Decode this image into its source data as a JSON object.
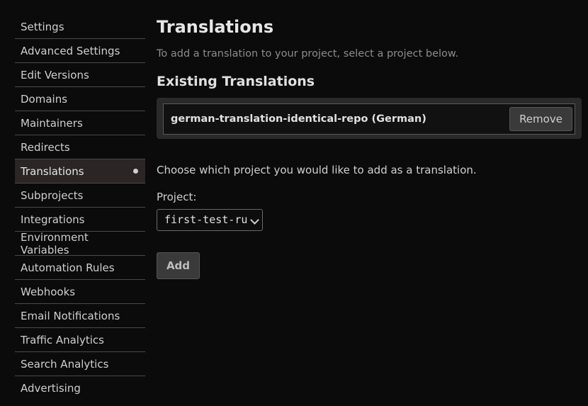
{
  "sidebar": {
    "items": [
      {
        "label": "Settings"
      },
      {
        "label": "Advanced Settings"
      },
      {
        "label": "Edit Versions"
      },
      {
        "label": "Domains"
      },
      {
        "label": "Maintainers"
      },
      {
        "label": "Redirects"
      },
      {
        "label": "Translations"
      },
      {
        "label": "Subprojects"
      },
      {
        "label": "Integrations"
      },
      {
        "label": "Environment Variables"
      },
      {
        "label": "Automation Rules"
      },
      {
        "label": "Webhooks"
      },
      {
        "label": "Email Notifications"
      },
      {
        "label": "Traffic Analytics"
      },
      {
        "label": "Search Analytics"
      },
      {
        "label": "Advertising"
      }
    ],
    "active_item": "Translations"
  },
  "main": {
    "title": "Translations",
    "subtitle": "To add a translation to your project, select a project below.",
    "existing_heading": "Existing Translations",
    "translations": [
      {
        "name": "german-translation-identical-repo (German)",
        "remove_label": "Remove"
      }
    ],
    "choose_text": "Choose which project you would like to add as a translation.",
    "project_label": "Project:",
    "project_select_value": "first-test-ru",
    "add_label": "Add"
  },
  "colors": {
    "background": "#0b0b0b",
    "active_item_bg": "#2b2525",
    "panel_bg": "#2a2a2a"
  }
}
